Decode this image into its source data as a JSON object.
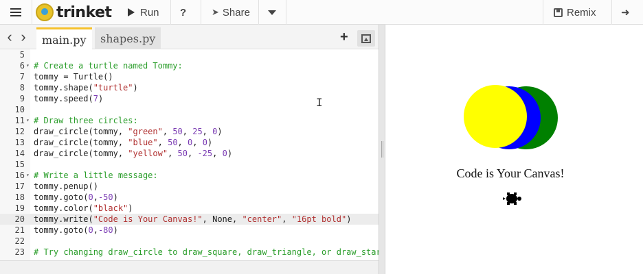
{
  "app": {
    "logo_text": "trinket",
    "run_label": "Run",
    "help_label": "?",
    "share_label": "Share",
    "remix_label": "Remix"
  },
  "tabs": [
    {
      "label": "main.py",
      "active": true
    },
    {
      "label": "shapes.py",
      "active": false
    }
  ],
  "editor": {
    "lines": [
      {
        "n": "5",
        "text": ""
      },
      {
        "n": "6",
        "text": "# Create a turtle named Tommy:"
      },
      {
        "n": "7",
        "text": "tommy = Turtle()"
      },
      {
        "n": "8",
        "text": "tommy.shape(\"turtle\")"
      },
      {
        "n": "9",
        "text": "tommy.speed(7)"
      },
      {
        "n": "10",
        "text": ""
      },
      {
        "n": "11",
        "text": "# Draw three circles:"
      },
      {
        "n": "12",
        "text": "draw_circle(tommy, \"green\", 50, 25, 0)"
      },
      {
        "n": "13",
        "text": "draw_circle(tommy, \"blue\", 50, 0, 0)"
      },
      {
        "n": "14",
        "text": "draw_circle(tommy, \"yellow\", 50, -25, 0)"
      },
      {
        "n": "15",
        "text": ""
      },
      {
        "n": "16",
        "text": "# Write a little message:"
      },
      {
        "n": "17",
        "text": "tommy.penup()"
      },
      {
        "n": "18",
        "text": "tommy.goto(0,-50)"
      },
      {
        "n": "19",
        "text": "tommy.color(\"black\")"
      },
      {
        "n": "20",
        "text": "tommy.write(\"Code is Your Canvas!\", None, \"center\", \"16pt bold\")"
      },
      {
        "n": "21",
        "text": "tommy.goto(0,-80)"
      },
      {
        "n": "22",
        "text": ""
      },
      {
        "n": "23",
        "text": "# Try changing draw_circle to draw_square, draw_triangle, or draw_star"
      }
    ],
    "current_line": "20"
  },
  "output": {
    "message": "Code is Your Canvas!",
    "circles": [
      {
        "color": "#008000"
      },
      {
        "color": "#0000ff"
      },
      {
        "color": "#ffff00"
      }
    ]
  },
  "colors": {
    "accent": "#f6c12b",
    "comment": "#2a9d2a",
    "string": "#b03030",
    "number": "#7a3bb3"
  },
  "icons": [
    "menu-icon",
    "trinket-logo-icon",
    "play-icon",
    "twitter-icon",
    "caret-down-icon",
    "save-icon",
    "login-icon",
    "back-arrow-icon",
    "forward-arrow-icon",
    "plus-icon",
    "image-icon",
    "turtle-icon"
  ]
}
